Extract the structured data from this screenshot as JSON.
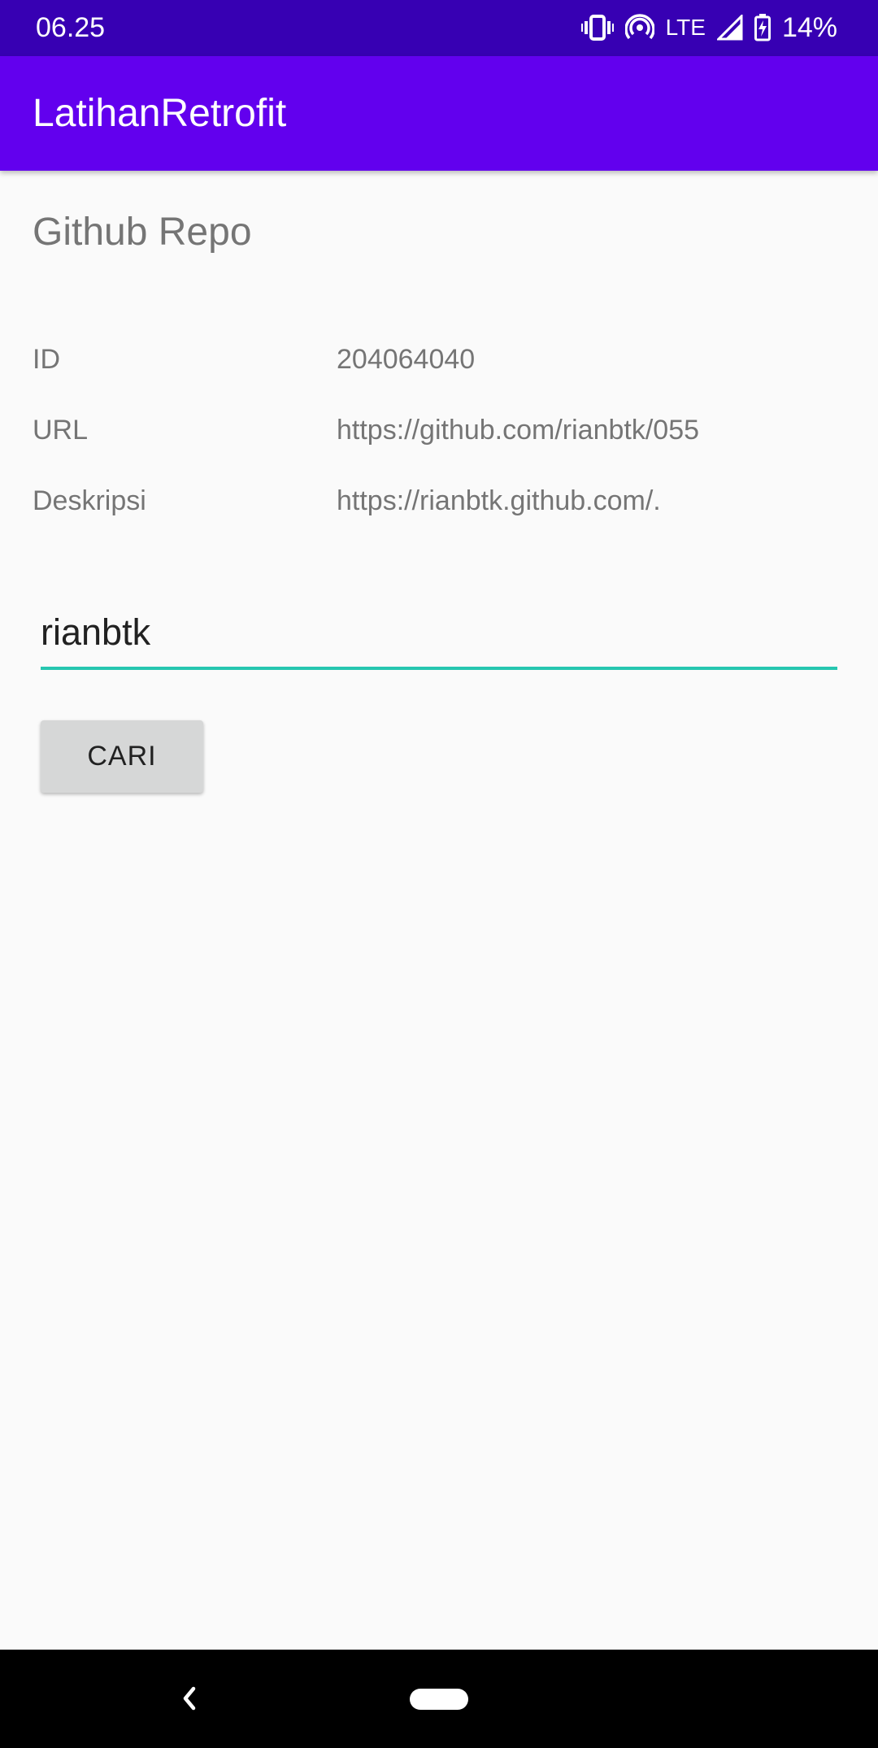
{
  "status_bar": {
    "time": "06.25",
    "network": "LTE",
    "battery": "14%",
    "icons": [
      "vibrate-icon",
      "hotspot-icon",
      "signal-icon",
      "battery-charging-icon"
    ]
  },
  "app_bar": {
    "title": "LatihanRetrofit",
    "color": "#6200ee"
  },
  "main": {
    "heading": "Github Repo",
    "rows": [
      {
        "label": "ID",
        "value": "204064040"
      },
      {
        "label": "URL",
        "value": "https://github.com/rianbtk/055"
      },
      {
        "label": "Deskripsi",
        "value": "https://rianbtk.github.com/."
      }
    ],
    "search": {
      "value": "rianbtk",
      "accent_color": "#26c6b0"
    },
    "button_label": "CARI"
  },
  "nav_bar": {
    "icons": [
      "back-icon",
      "home-pill-icon"
    ]
  }
}
